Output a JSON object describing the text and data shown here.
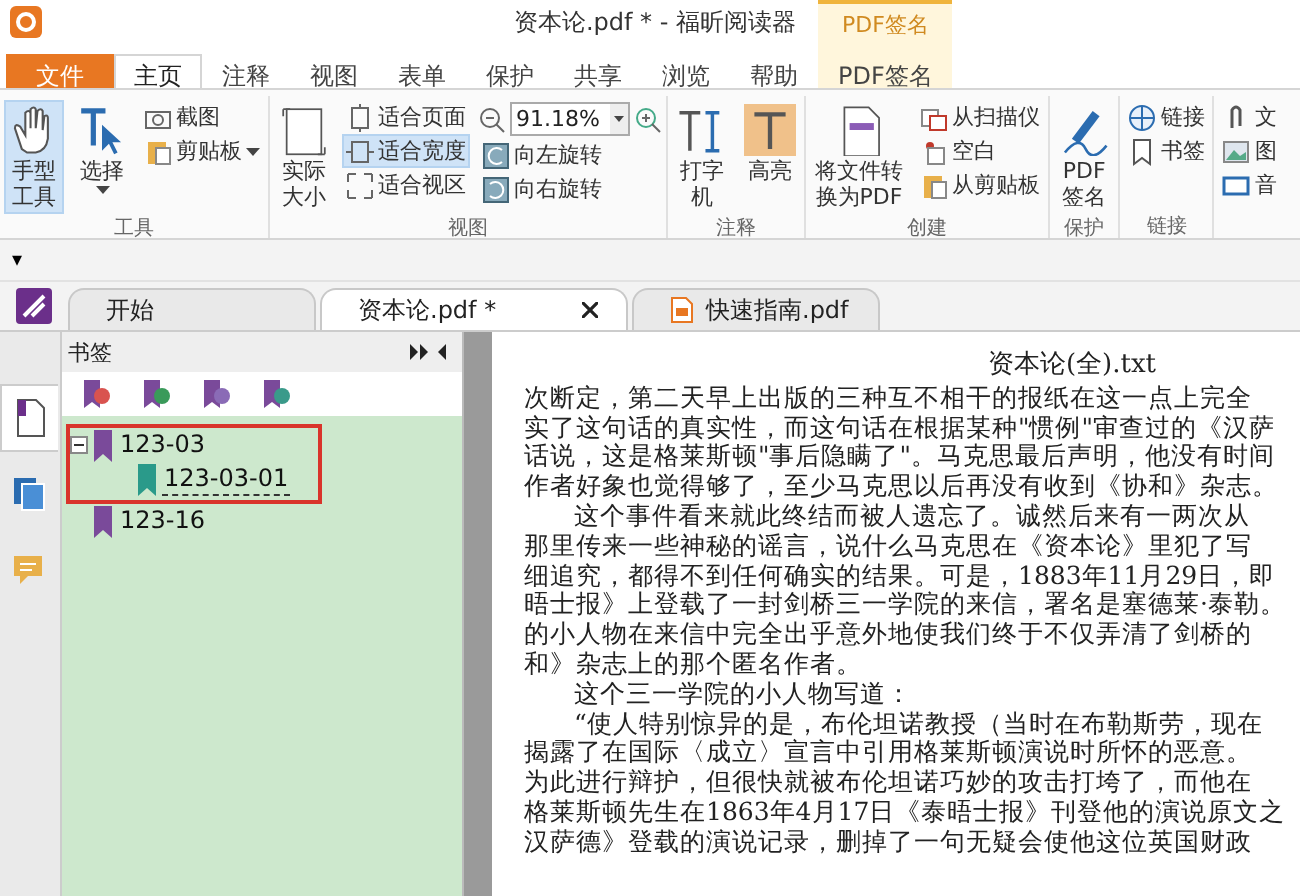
{
  "window": {
    "title": "资本论.pdf * - 福昕阅读器"
  },
  "ribbon_tabs": [
    {
      "label": "文件",
      "kind": "file",
      "selected": false
    },
    {
      "label": "主页",
      "kind": "tab",
      "selected": true
    },
    {
      "label": "注释",
      "kind": "tab",
      "selected": false
    },
    {
      "label": "视图",
      "kind": "tab",
      "selected": false
    },
    {
      "label": "表单",
      "kind": "tab",
      "selected": false
    },
    {
      "label": "保护",
      "kind": "tab",
      "selected": false
    },
    {
      "label": "共享",
      "kind": "tab",
      "selected": false
    },
    {
      "label": "浏览",
      "kind": "tab",
      "selected": false
    },
    {
      "label": "帮助",
      "kind": "tab",
      "selected": false
    },
    {
      "label": "PDF签名",
      "kind": "context",
      "context_label": "PDF签名",
      "selected": false
    }
  ],
  "ribbon_groups": [
    {
      "label": "工具",
      "items": [
        {
          "kind": "large",
          "label": "手型工具",
          "selected": true
        },
        {
          "kind": "large",
          "label": "选择",
          "dropdown": true,
          "selected": false
        },
        {
          "kind": "column",
          "items": [
            {
              "label": "截图",
              "selected": false
            },
            {
              "label": "剪贴板",
              "dropdown": true,
              "selected": false
            }
          ]
        }
      ]
    },
    {
      "label": "视图",
      "items": [
        {
          "kind": "large",
          "label": "实际大小",
          "selected": false
        },
        {
          "kind": "column",
          "items": [
            {
              "label": "适合页面",
              "selected": false
            },
            {
              "label": "适合宽度",
              "selected": true
            },
            {
              "label": "适合视区",
              "selected": false
            }
          ]
        },
        {
          "kind": "zoom",
          "value": "91.18%",
          "items": [
            {
              "label": "向左旋转",
              "selected": false
            },
            {
              "label": "向右旋转",
              "selected": false
            }
          ]
        }
      ]
    },
    {
      "label": "注释",
      "items": [
        {
          "kind": "large",
          "label": "打字机",
          "selected": false
        },
        {
          "kind": "large",
          "label": "高亮",
          "selected": false
        }
      ]
    },
    {
      "label": "创建",
      "items": [
        {
          "kind": "large",
          "label": "将文件转换为PDF",
          "selected": false
        },
        {
          "kind": "column",
          "items": [
            {
              "label": "从扫描仪",
              "selected": false
            },
            {
              "label": "空白",
              "selected": false
            },
            {
              "label": "从剪贴板",
              "selected": false
            }
          ]
        }
      ]
    },
    {
      "label": "保护",
      "items": [
        {
          "kind": "large",
          "label": "PDF签名",
          "selected": false
        }
      ]
    },
    {
      "label": "链接",
      "items": [
        {
          "kind": "column",
          "items": [
            {
              "label": "链接",
              "selected": false
            },
            {
              "label": "书签",
              "selected": false
            }
          ]
        }
      ]
    },
    {
      "items": [
        {
          "kind": "column",
          "items": [
            {
              "label": "文",
              "selected": false
            },
            {
              "label": "图",
              "selected": false
            },
            {
              "label": "音",
              "selected": false
            }
          ]
        }
      ]
    }
  ],
  "quick_access": {
    "label": "▾"
  },
  "doc_tabs": [
    {
      "label": "开始",
      "selected": false,
      "closable": false
    },
    {
      "label": "资本论.pdf *",
      "selected": true,
      "closable": true
    },
    {
      "label": "快速指南.pdf",
      "selected": false,
      "closable": false
    }
  ],
  "bookmarks": {
    "title": "书签",
    "tree": [
      {
        "label": "123-03",
        "expanded": true,
        "highlighted": true,
        "selected": false,
        "children": [
          {
            "label": "123-03-01",
            "selected": true
          }
        ]
      },
      {
        "label": "123-16",
        "highlighted": false,
        "selected": false
      }
    ]
  },
  "side_tabs": [
    {
      "selected": true
    },
    {
      "selected": false
    },
    {
      "selected": false
    }
  ],
  "document": {
    "title": "资本论(全).txt",
    "lines": [
      {
        "text": "次断定，第二天早上出版的三种互不相干的报纸在这一点上完全",
        "indent": false
      },
      {
        "text": "实了这句话的真实性，而这句话在根据某种\"惯例\"审查过的《汉萨",
        "indent": false
      },
      {
        "text": "话说，这是格莱斯顿\"事后隐瞒了\"。马克思最后声明，他没有时间",
        "indent": false
      },
      {
        "text": "作者好象也觉得够了，至少马克思以后再没有收到《协和》杂志。",
        "indent": false
      },
      {
        "text": "这个事件看来就此终结而被人遗忘了。诚然后来有一两次从",
        "indent": true
      },
      {
        "text": "那里传来一些神秘的谣言，说什么马克思在《资本论》里犯了写",
        "indent": false
      },
      {
        "text": "细追究，都得不到任何确实的结果。可是，1883年11月29日，即",
        "indent": false
      },
      {
        "text": "晤士报》上登载了一封剑桥三一学院的来信，署名是塞德莱·泰勒。",
        "indent": false
      },
      {
        "text": "的小人物在来信中完全出乎意外地使我们终于不仅弄清了剑桥的",
        "indent": false
      },
      {
        "text": "和》杂志上的那个匿名作者。",
        "indent": false
      },
      {
        "text": "这个三一学院的小人物写道：",
        "indent": true
      },
      {
        "text": "“使人特别惊异的是，布伦坦诺教授（当时在布勒斯劳，现在",
        "indent": true
      },
      {
        "text": "揭露了在国际〈成立〉宣言中引用格莱斯顿演说时所怀的恶意。",
        "indent": false
      },
      {
        "text": "为此进行辩护，但很快就被布伦坦诺巧妙的攻击打垮了，而他在",
        "indent": false
      },
      {
        "text": "格莱斯顿先生在1863年4月17日《泰晤士报》刊登他的演说原文之",
        "indent": false
      },
      {
        "text": "汉萨德》登载的演说记录，删掉了一句无疑会使他这位英国财政",
        "indent": false
      }
    ]
  }
}
